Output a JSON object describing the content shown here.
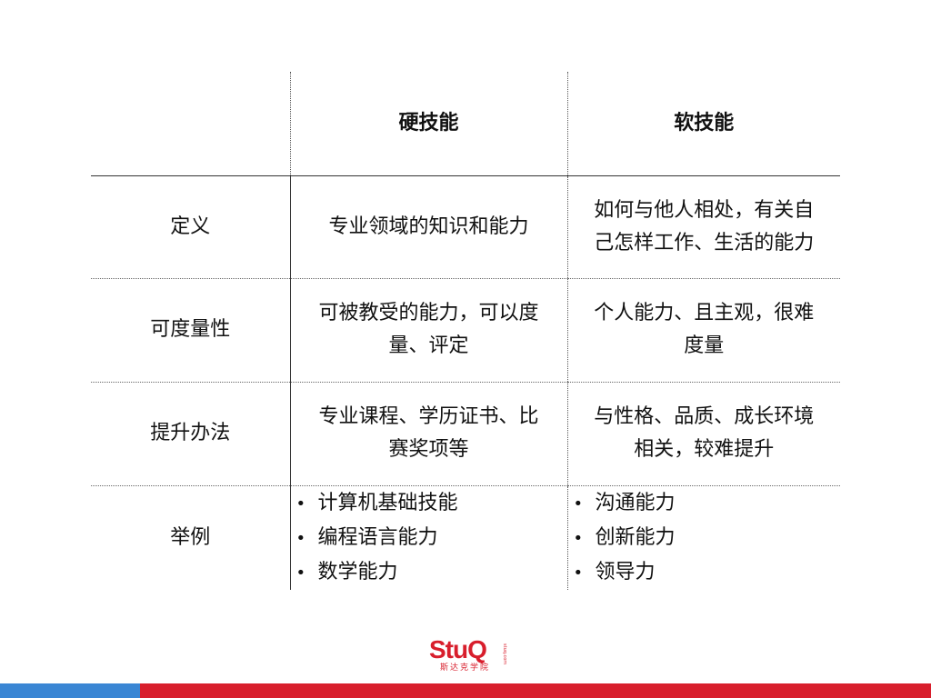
{
  "table": {
    "headers": {
      "hard": "硬技能",
      "soft": "软技能"
    },
    "rows": [
      {
        "label": "定义",
        "hard": "专业领域的知识和能力",
        "soft": [
          "如何与他人相处，有关自",
          "己怎样工作、生活的能力"
        ]
      },
      {
        "label": "可度量性",
        "hard": [
          "可被教受的能力，可以度",
          "量、评定"
        ],
        "soft": [
          "个人能力、且主观，很难",
          "度量"
        ]
      },
      {
        "label": "提升办法",
        "hard": [
          "专业课程、学历证书、比",
          "赛奖项等"
        ],
        "soft": [
          "与性格、品质、成长环境",
          "相关，较难提升"
        ]
      },
      {
        "label": "举例",
        "hard_items": [
          "计算机基础技能",
          "编程语言能力",
          "数学能力"
        ],
        "soft_items": [
          "沟通能力",
          "创新能力",
          "领导力"
        ]
      }
    ],
    "bullet": "•"
  },
  "logo": {
    "word": "StuQ",
    "subtitle": "斯达克学院",
    "mark": "stuq.com"
  },
  "colors": {
    "brand_red": "#d81e2c",
    "bar_blue": "#3a86d4",
    "bar_red": "#d81e2c"
  }
}
